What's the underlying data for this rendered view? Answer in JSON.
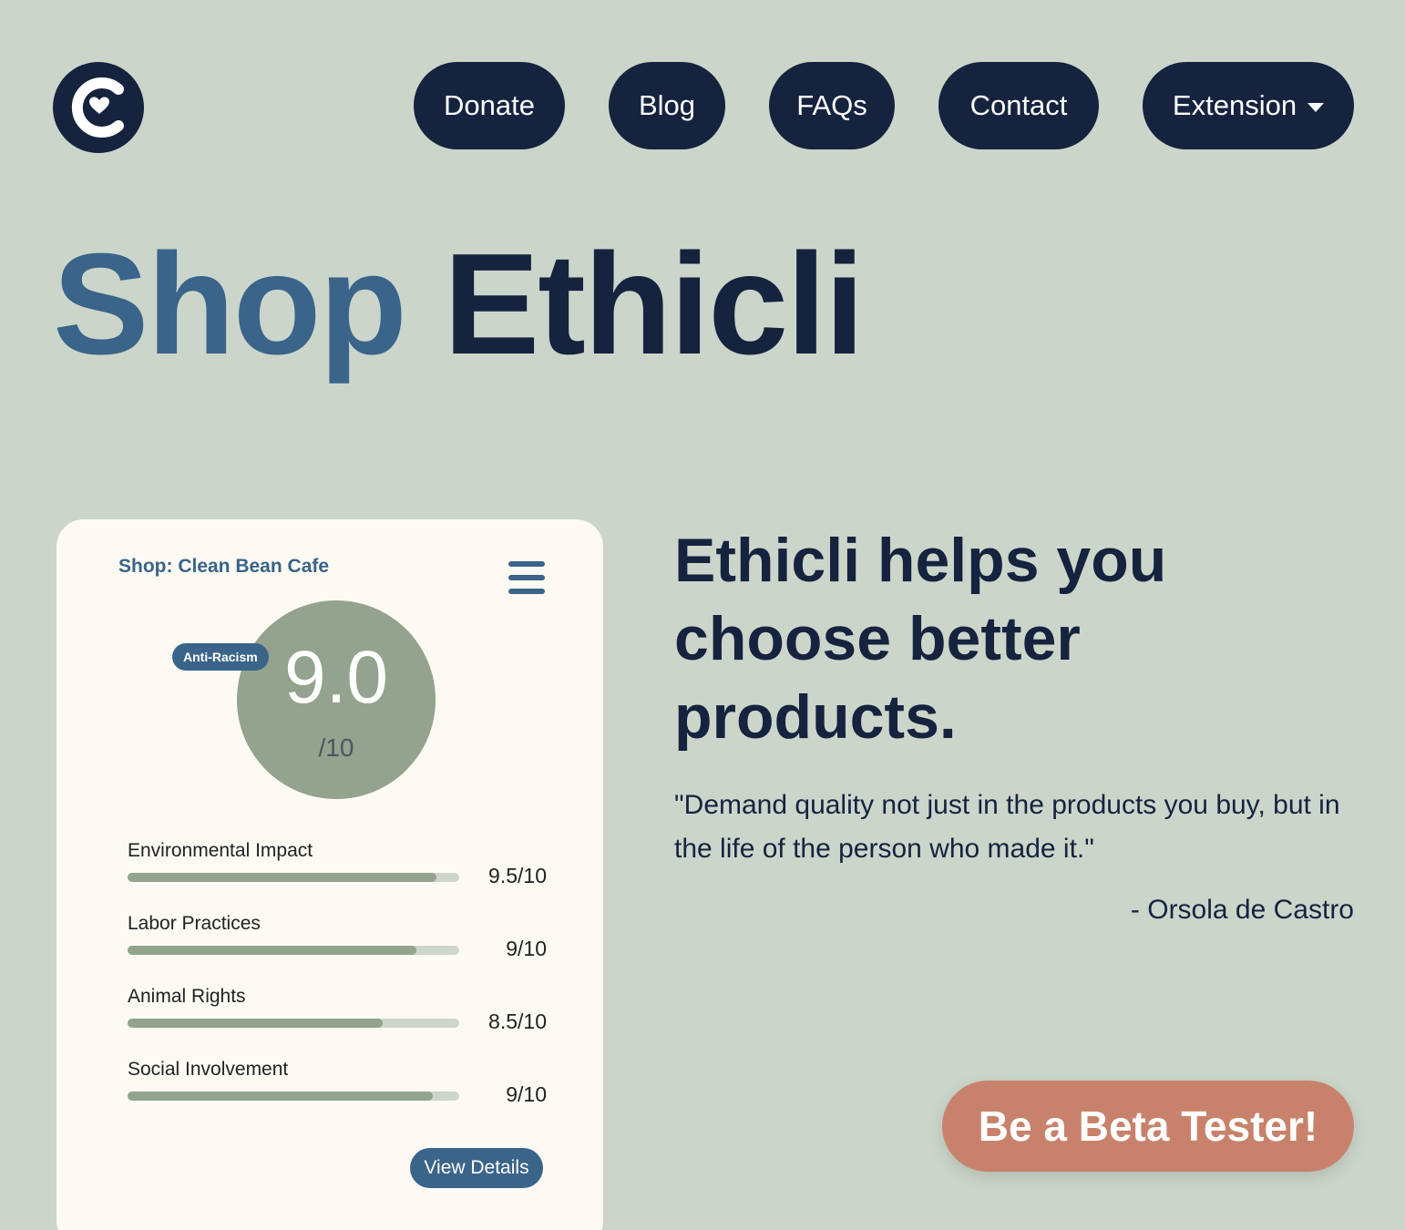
{
  "nav": {
    "donate": "Donate",
    "blog": "Blog",
    "faqs": "FAQs",
    "contact": "Contact",
    "extension": "Extension"
  },
  "hero": {
    "shop": "Shop",
    "brand": "Ethicli"
  },
  "card": {
    "shop_label": "Shop: Clean Bean Cafe",
    "badge": "Anti-Racism",
    "score": "9.0",
    "score_max": "/10",
    "metrics": [
      {
        "label": "Environmental Impact",
        "value": "9.5/10",
        "fraction": 0.93
      },
      {
        "label": "Labor Practices",
        "value": "9/10",
        "fraction": 0.87
      },
      {
        "label": "Animal Rights",
        "value": "8.5/10",
        "fraction": 0.77
      },
      {
        "label": "Social Involvement",
        "value": "9/10",
        "fraction": 0.92
      }
    ],
    "view_details": "View Details"
  },
  "tagline": "Ethicli helps you choose better products.",
  "quote": "\"Demand quality not just in the products you buy, but in the life of the person who made it.\"",
  "author": "- Orsola de Castro",
  "beta_button": "Be a Beta Tester!",
  "colors": {
    "background": "#cbd5ca",
    "navy": "#15233f",
    "accent_blue": "#3a6489",
    "sage": "#93a38d",
    "card": "#fcfaf3",
    "cta": "#c8826b"
  }
}
